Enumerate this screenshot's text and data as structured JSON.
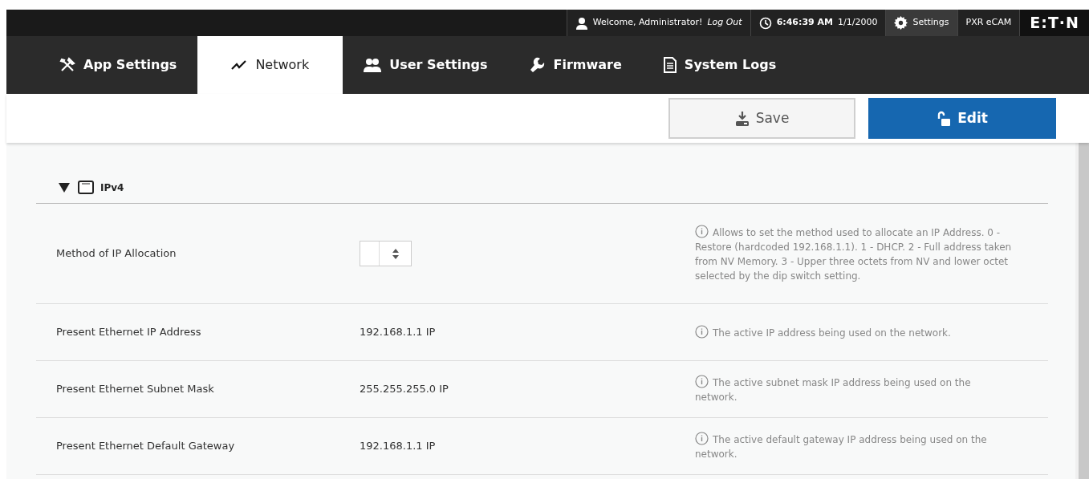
{
  "top_bar": [
    {
      "kind": "user",
      "text": "Welcome, Administrator!",
      "link": "Log Out"
    },
    {
      "kind": "clock",
      "time": "6:46:39 AM",
      "date": "1/1/2000"
    },
    {
      "kind": "settings",
      "text": "Settings"
    },
    {
      "kind": "plain",
      "text": "PXR eCAM"
    },
    {
      "kind": "logo",
      "text": "E:T·N"
    }
  ],
  "tabs": [
    {
      "label": "App Settings",
      "kind": "tools",
      "selected": false
    },
    {
      "label": "Network",
      "kind": "pulse",
      "selected": true
    },
    {
      "label": "User Settings",
      "kind": "users",
      "selected": false
    },
    {
      "label": "Firmware",
      "kind": "wrench",
      "selected": false
    },
    {
      "label": "System Logs",
      "kind": "document",
      "selected": false
    }
  ],
  "toolbar": {
    "save": "Save",
    "edit": "Edit"
  },
  "section": {
    "title": "IPv4",
    "expanded": true,
    "rows": [
      {
        "label": "Method of IP Allocation",
        "kind": "select",
        "description": "Allows to set the method used to allocate an IP Address. 0 - Restore (hardcoded 192.168.1.1). 1 - DHCP. 2 - Full address taken from NV Memory. 3 - Upper three octets from NV and lower octet selected by the dip switch setting."
      },
      {
        "label": "Present Ethernet IP Address",
        "kind": "text",
        "value": "192.168.1.1 IP",
        "description": "The active IP address being used on the network."
      },
      {
        "label": "Present Ethernet Subnet Mask",
        "kind": "text",
        "value": "255.255.255.0 IP",
        "description": "The active subnet mask IP address being used on the network."
      },
      {
        "label": "Present Ethernet Default Gateway",
        "kind": "text",
        "value": "192.168.1.1 IP",
        "description": "The active default gateway IP address being used on the network."
      }
    ]
  }
}
